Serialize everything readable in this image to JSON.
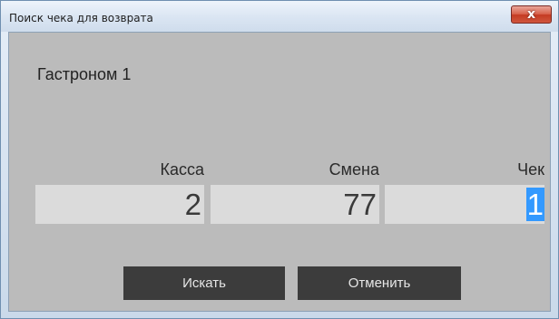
{
  "window": {
    "title": "Поиск чека для возврата",
    "close_glyph": "x"
  },
  "store": {
    "name": "Гастроном 1"
  },
  "fields": {
    "kassa": {
      "label": "Касса",
      "value": "2"
    },
    "smena": {
      "label": "Смена",
      "value": "77"
    },
    "chek": {
      "label": "Чек",
      "value": "1"
    }
  },
  "buttons": {
    "search_label": "Искать",
    "cancel_label": "Отменить"
  },
  "colors": {
    "dialog_background": "#bbbbbb",
    "field_background": "#dbdbdb",
    "button_background": "#3c3c3c",
    "selection": "#3399ff",
    "close_button": "#c43b22"
  },
  "icons": {
    "close": "close-icon"
  }
}
